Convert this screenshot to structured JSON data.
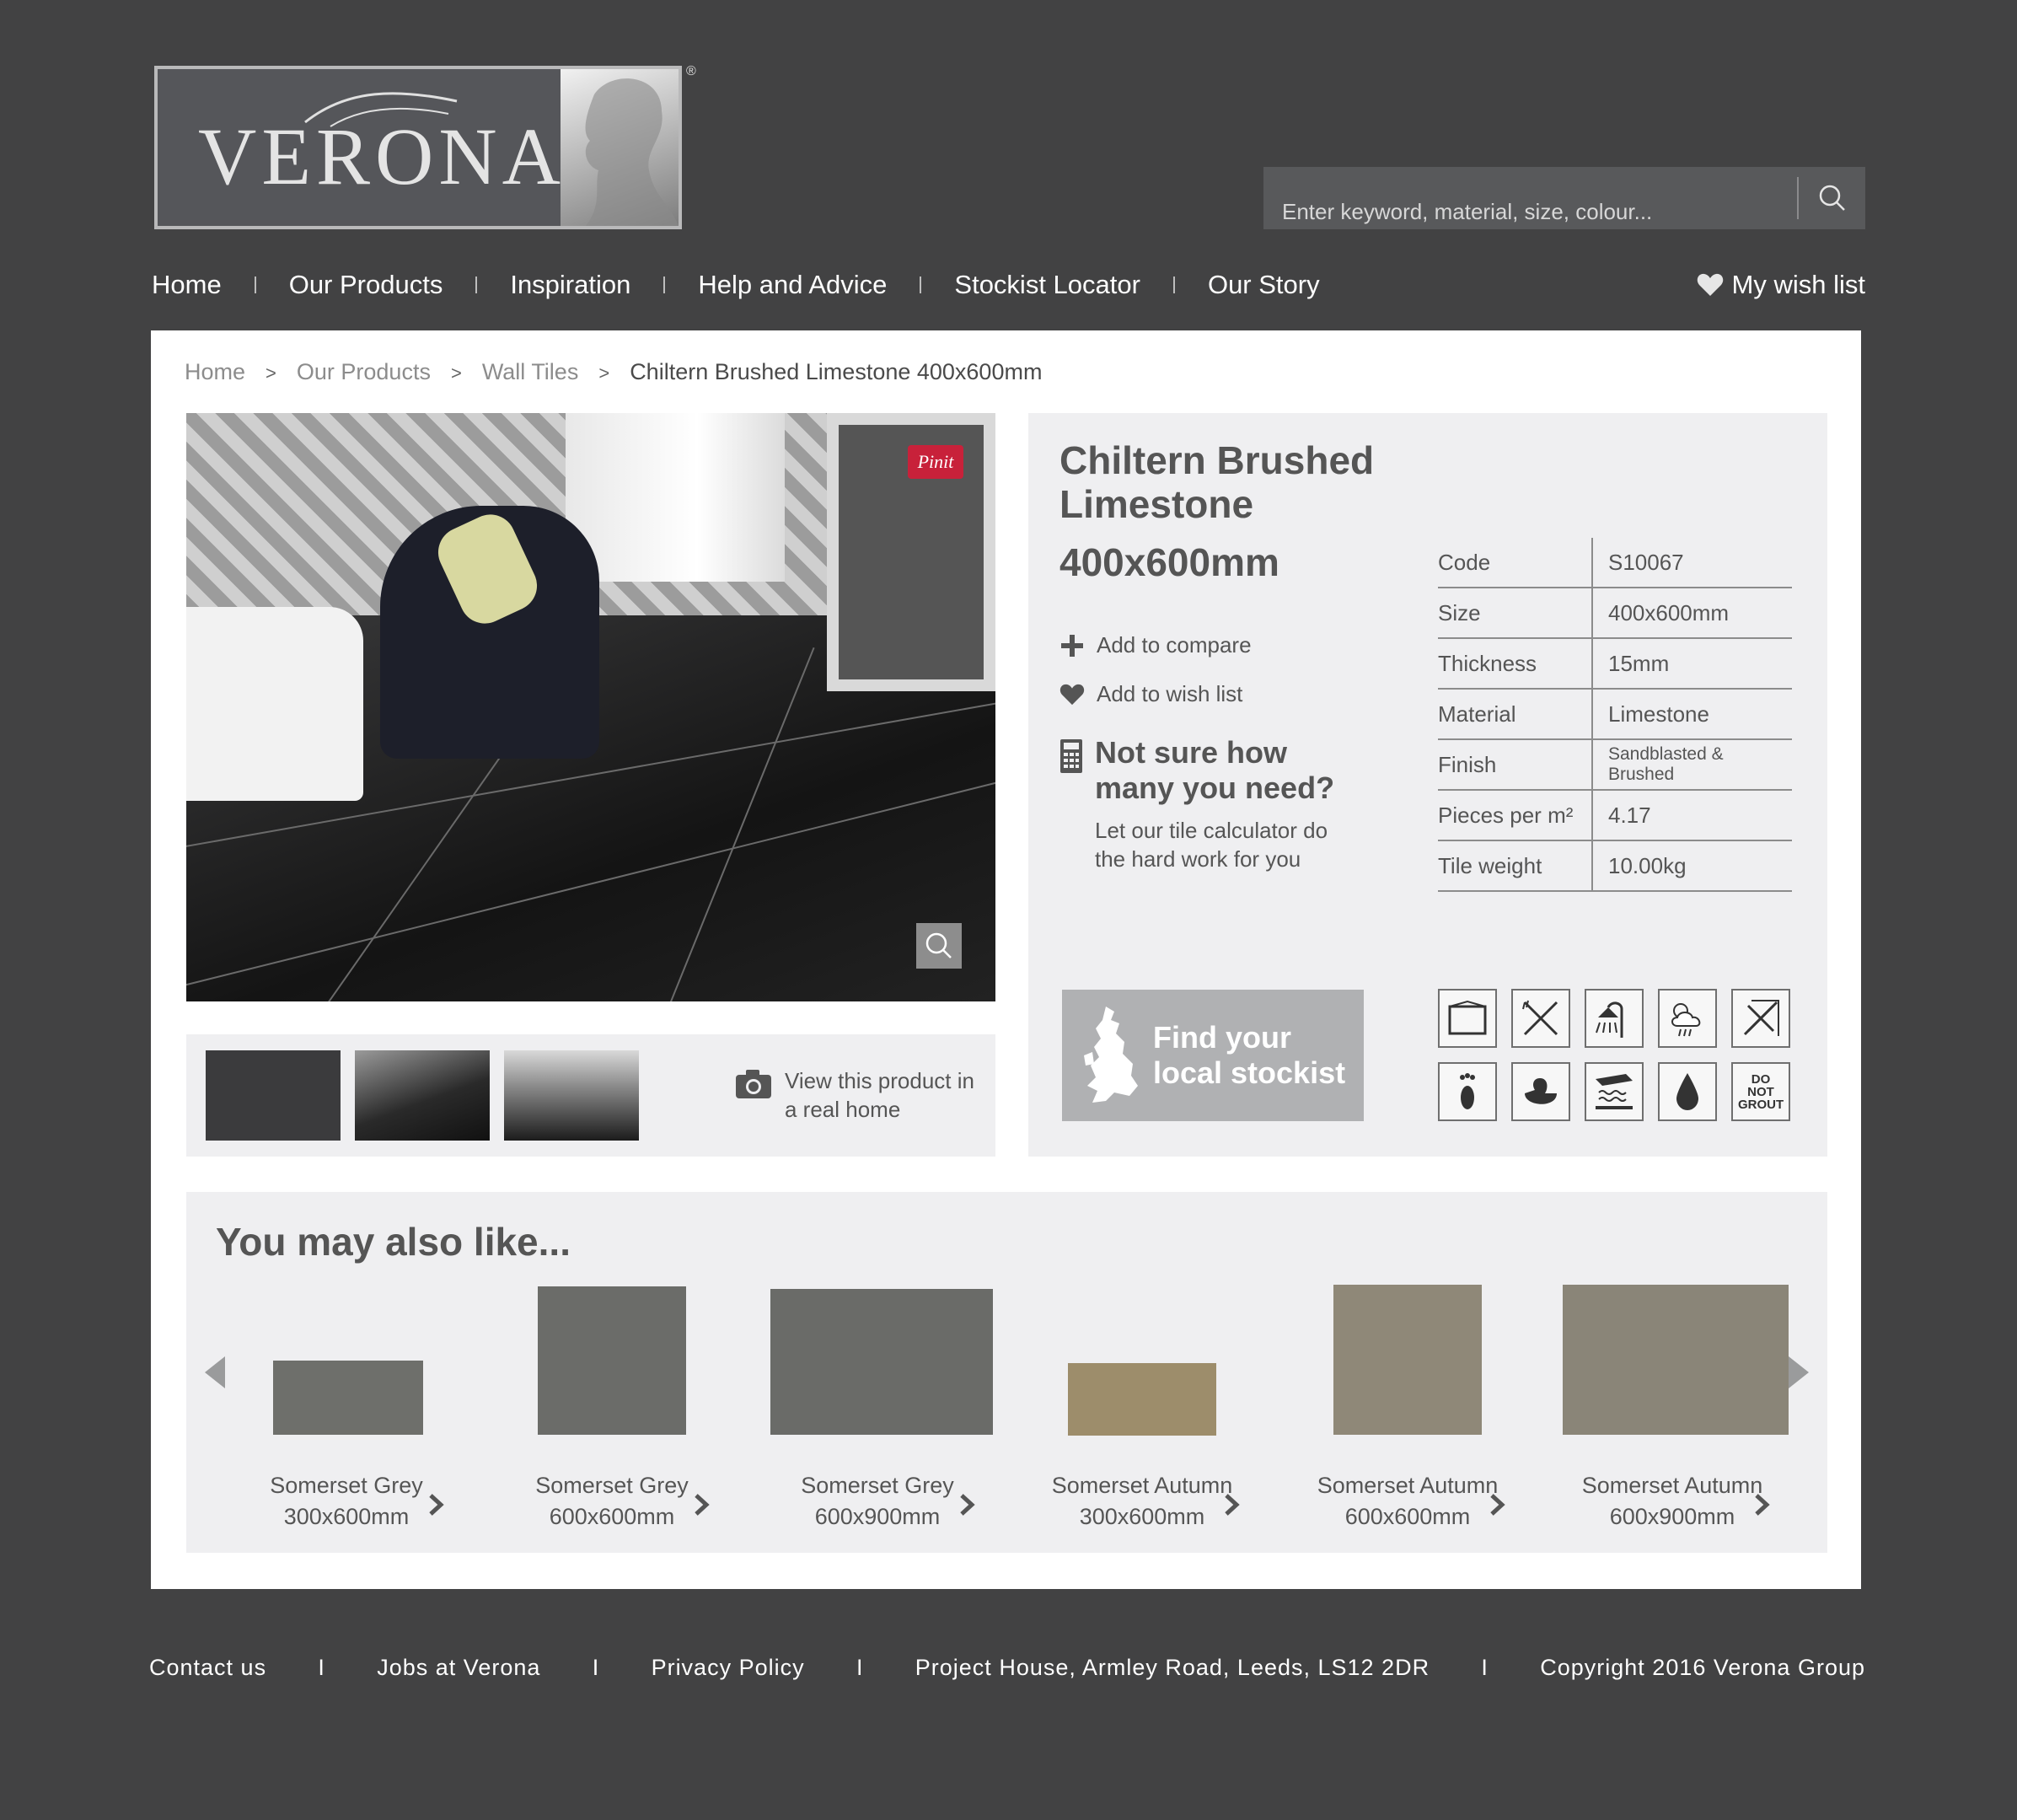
{
  "brand": {
    "logo_text": "VERONA",
    "reg_mark": "®"
  },
  "search": {
    "placeholder": "Enter keyword, material, size, colour..."
  },
  "nav": {
    "items": [
      "Home",
      "Our Products",
      "Inspiration",
      "Help and Advice",
      "Stockist Locator",
      "Our Story"
    ],
    "wishlist_label": "My wish list"
  },
  "breadcrumb": [
    "Home",
    "Our Products",
    "Wall Tiles",
    "Chiltern Brushed Limestone 400x600mm"
  ],
  "breadcrumb_separator": ">",
  "product": {
    "title": "Chiltern Brushed Limestone",
    "size_heading": "400x600mm",
    "pinit_label": "Pinit",
    "actions": {
      "compare": "Add to compare",
      "wishlist": "Add to wish list"
    },
    "calculator": {
      "heading": "Not sure how many you need?",
      "text": "Let our tile calculator do the hard work for you"
    },
    "view_real_home": "View this product in a real home",
    "specs": [
      {
        "key": "Code",
        "value": "S10067"
      },
      {
        "key": "Size",
        "value": "400x600mm"
      },
      {
        "key": "Thickness",
        "value": "15mm"
      },
      {
        "key": "Material",
        "value": "Limestone"
      },
      {
        "key": "Finish",
        "value": "Sandblasted & Brushed"
      },
      {
        "key": "Pieces per m²",
        "value": "4.17"
      },
      {
        "key": "Tile weight",
        "value": "10.00kg"
      }
    ],
    "stockist_button": "Find your local stockist",
    "usage_icons": [
      "wall-icon",
      "kitchen-icon",
      "shower-icon",
      "outdoor-weather-icon",
      "no-cutting-icon",
      "floor-footprint-icon",
      "bathroom-duck-icon",
      "underfloor-heating-icon",
      "water-drop-icon",
      "do-not-grout-icon"
    ],
    "do_not_grout_label": "DO NOT GROUT"
  },
  "also_like": {
    "heading": "You may also like...",
    "items": [
      {
        "name": "Somerset Grey",
        "size": "300x600mm",
        "color": "#6e6f6b"
      },
      {
        "name": "Somerset Grey",
        "size": "600x600mm",
        "color": "#6b6c69"
      },
      {
        "name": "Somerset Grey",
        "size": "600x900mm",
        "color": "#6a6b68"
      },
      {
        "name": "Somerset Autumn",
        "size": "300x600mm",
        "color": "#9d8d6b"
      },
      {
        "name": "Somerset Autumn",
        "size": "600x600mm",
        "color": "#8f8878"
      },
      {
        "name": "Somerset Autumn",
        "size": "600x900mm",
        "color": "#8a8578"
      }
    ]
  },
  "footer": [
    "Contact us",
    "Jobs at Verona",
    "Privacy Policy",
    "Project House, Armley Road, Leeds, LS12 2DR",
    "Copyright 2016 Verona Group"
  ],
  "colors": {
    "background": "#424243",
    "panel": "#ffffff",
    "box": "#efeff1",
    "pinit": "#c8213a",
    "stockist_button": "#b0b1b3"
  }
}
